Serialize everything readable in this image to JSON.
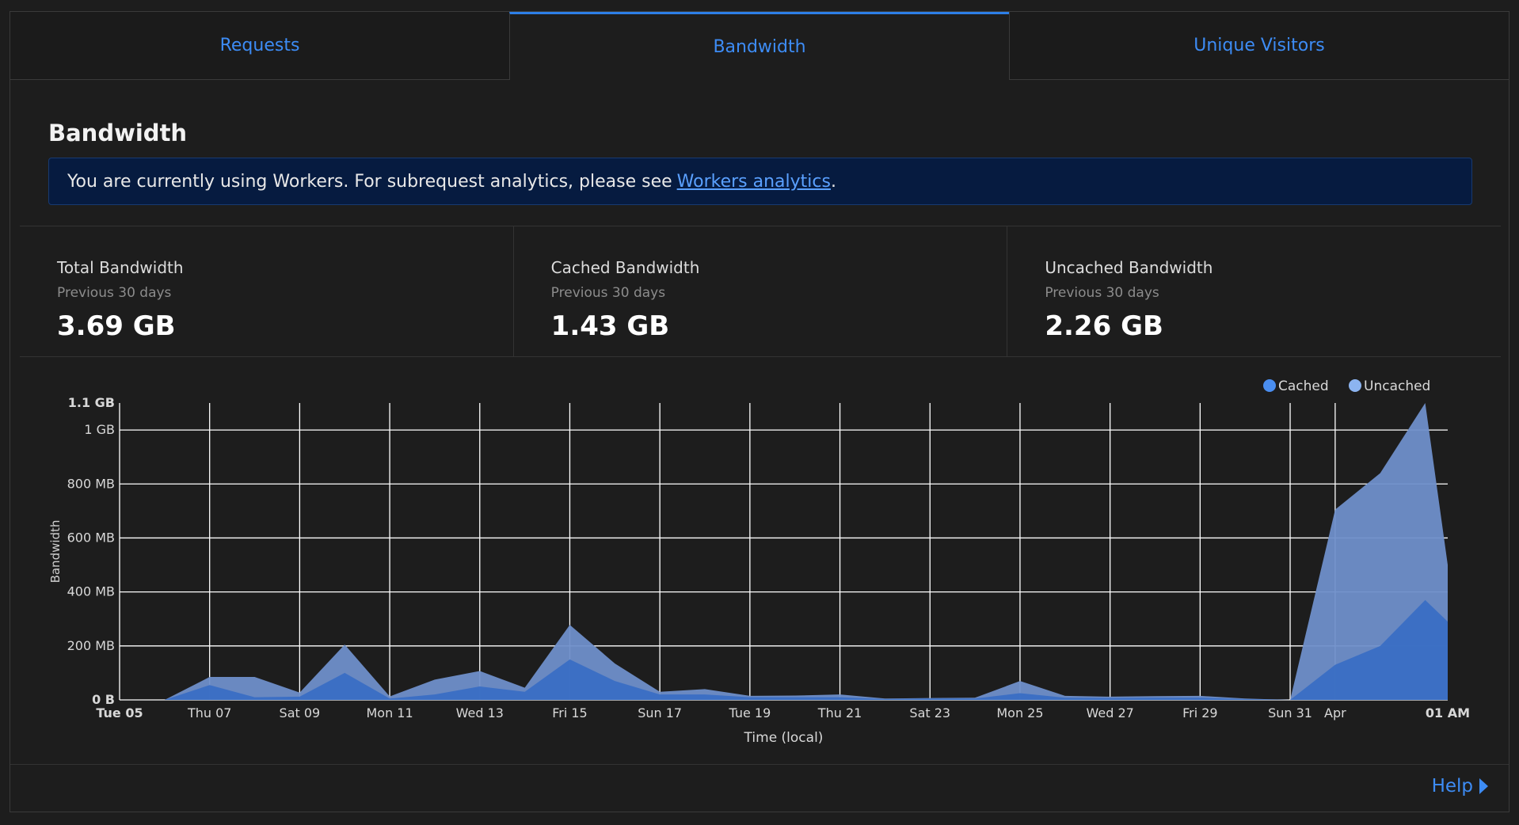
{
  "tabs": [
    {
      "label": "Requests",
      "active": false
    },
    {
      "label": "Bandwidth",
      "active": true
    },
    {
      "label": "Unique Visitors",
      "active": false
    }
  ],
  "section_title": "Bandwidth",
  "banner": {
    "text": "You are currently using Workers. For subrequest analytics, please see",
    "link": "Workers analytics",
    "suffix": "."
  },
  "stats": [
    {
      "label": "Total Bandwidth",
      "sub": "Previous 30 days",
      "value": "3.69 GB"
    },
    {
      "label": "Cached Bandwidth",
      "sub": "Previous 30 days",
      "value": "1.43 GB"
    },
    {
      "label": "Uncached Bandwidth",
      "sub": "Previous 30 days",
      "value": "2.26 GB"
    }
  ],
  "help_label": "Help",
  "colors": {
    "accent": "#3d8cf5",
    "cached": "#3670c8",
    "uncached": "#6e8fc8"
  },
  "chart_data": {
    "type": "area",
    "stacked": true,
    "xlabel": "Time (local)",
    "ylabel": "Bandwidth",
    "ylim_mb": [
      0,
      1100
    ],
    "yticks": [
      {
        "value": 0,
        "label": "0 B",
        "bold": true
      },
      {
        "value": 200,
        "label": "200 MB"
      },
      {
        "value": 400,
        "label": "400 MB"
      },
      {
        "value": 600,
        "label": "600 MB"
      },
      {
        "value": 800,
        "label": "800 MB"
      },
      {
        "value": 1000,
        "label": "1 GB"
      },
      {
        "value": 1100,
        "label": "1.1 GB",
        "bold": true
      }
    ],
    "xticks": [
      {
        "label": "Tue 05",
        "day": 0,
        "bold": true
      },
      {
        "label": "Thu 07",
        "day": 2
      },
      {
        "label": "Sat 09",
        "day": 4
      },
      {
        "label": "Mon 11",
        "day": 6
      },
      {
        "label": "Wed 13",
        "day": 8
      },
      {
        "label": "Fri 15",
        "day": 10
      },
      {
        "label": "Sun 17",
        "day": 12
      },
      {
        "label": "Tue 19",
        "day": 14
      },
      {
        "label": "Thu 21",
        "day": 16
      },
      {
        "label": "Sat 23",
        "day": 18
      },
      {
        "label": "Mon 25",
        "day": 20
      },
      {
        "label": "Wed 27",
        "day": 22
      },
      {
        "label": "Fri 29",
        "day": 24
      },
      {
        "label": "Sun 31",
        "day": 26
      },
      {
        "label": "Apr",
        "day": 27
      },
      {
        "label": "01 AM",
        "day": 29.5,
        "bold": true
      }
    ],
    "legend": [
      {
        "name": "Cached",
        "color": "#4a8ef0"
      },
      {
        "name": "Uncached",
        "color": "#8cb4f0"
      }
    ],
    "legend_position": "top-right",
    "grid": true,
    "day": [
      0,
      1,
      2,
      3,
      4,
      5,
      6,
      7,
      8,
      9,
      10,
      11,
      12,
      13,
      14,
      15,
      16,
      17,
      18,
      19,
      20,
      21,
      22,
      23,
      24,
      25,
      26,
      27,
      28,
      29,
      29.5
    ],
    "series": [
      {
        "name": "Cached",
        "values": [
          0,
          0,
          55,
          10,
          12,
          100,
          5,
          20,
          50,
          30,
          150,
          70,
          20,
          20,
          10,
          10,
          10,
          3,
          5,
          5,
          25,
          8,
          7,
          8,
          8,
          3,
          0,
          130,
          200,
          370,
          290
        ]
      },
      {
        "name": "Uncached",
        "values": [
          0,
          0,
          30,
          75,
          15,
          105,
          8,
          55,
          57,
          15,
          128,
          65,
          10,
          20,
          5,
          6,
          10,
          2,
          2,
          3,
          45,
          7,
          5,
          6,
          7,
          2,
          0,
          575,
          640,
          730,
          210
        ]
      }
    ]
  }
}
